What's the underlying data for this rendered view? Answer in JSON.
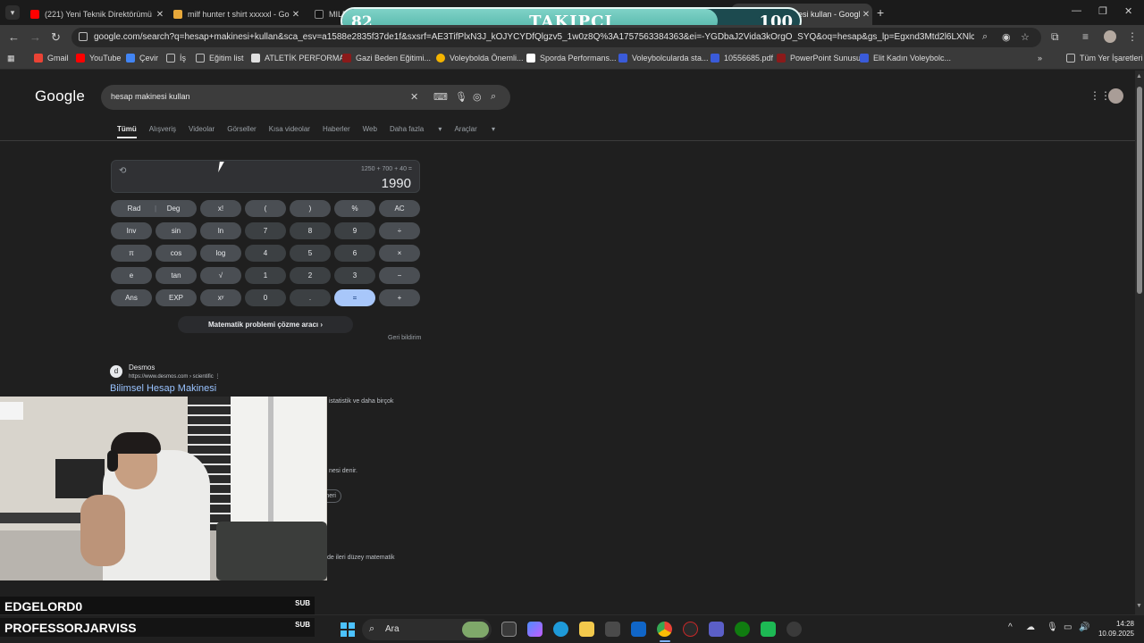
{
  "browser": {
    "tabs": [
      {
        "title": "(221) Yeni Teknik Direktörümü",
        "favicon_color": "#ff0000",
        "active": false
      },
      {
        "title": "milf hunter t shirt xxxxxl - Goog",
        "favicon_color": "#e7a83a",
        "active": false
      },
      {
        "title": "MILF",
        "favicon_color": "#111111",
        "active": false
      },
      {
        "title": "hesap makinesi kullan - Google",
        "favicon_color": "#5f8cff",
        "active": true
      }
    ],
    "new_tab_icon": "plus-icon",
    "url": "google.com/search?q=hesap+makinesi+kullan&sca_esv=a1588e2835f37de1f&sxsrf=AE3TifPlxN3J_kOJYCYDfQlgzv5_1w0z8Q%3A1757563384363&ei=-YGDbaJ2Vida3kOrgO_SYQ&oq=hesap&gs_lp=Egxnd3Mtd2l6LXNlcnAiBWhlc2FwKgIIAD..."
  },
  "overlay": {
    "current": "82",
    "label": "TAKIPÇI",
    "goal": "100",
    "progress": 0.82
  },
  "bookmarks": [
    {
      "label": "Gmail",
      "color": "#ea4335"
    },
    {
      "label": "YouTube",
      "color": "#ff0000"
    },
    {
      "label": "Çevir",
      "color": "#4285f4"
    },
    {
      "label": "İş",
      "color": "#9e9e9e"
    },
    {
      "label": "Eğitim list",
      "color": "#9e9e9e"
    },
    {
      "label": "ATLETİK PERFORMA...",
      "color": "#e0e0e0"
    },
    {
      "label": "Gazi Beden Eğitimi...",
      "color": "#8b1a1a"
    },
    {
      "label": "Voleybolda Önemli...",
      "color": "#f4b400"
    },
    {
      "label": "Sporda Performans...",
      "color": "#ffffff"
    },
    {
      "label": "Voleybolcularda sta...",
      "color": "#3a5bd9"
    },
    {
      "label": "10556685.pdf",
      "color": "#3a5bd9"
    },
    {
      "label": "PowerPoint Sunusu",
      "color": "#8b1a1a"
    },
    {
      "label": "Elit Kadın Voleybolc...",
      "color": "#3a5bd9"
    }
  ],
  "bookmarks_all": "Tüm Yer İşaretleri",
  "google": {
    "logo": "Google",
    "query": "hesap makinesi kullan",
    "tabs": [
      "Tümü",
      "Alışveriş",
      "Videolar",
      "Görseller",
      "Kısa videolar",
      "Haberler",
      "Web",
      "Daha fazla",
      "Araçlar"
    ]
  },
  "calculator": {
    "expression": "1250 + 700 + 40 =",
    "result": "1990",
    "keys": [
      [
        "Rad|Deg",
        "x!",
        "(",
        ")",
        "%",
        "AC"
      ],
      [
        "Inv",
        "sin",
        "ln",
        "7",
        "8",
        "9",
        "÷"
      ],
      [
        "π",
        "cos",
        "log",
        "4",
        "5",
        "6",
        "×"
      ],
      [
        "e",
        "tan",
        "√",
        "1",
        "2",
        "3",
        "−"
      ],
      [
        "Ans",
        "EXP",
        "xʸ",
        "0",
        ".",
        "=",
        "+"
      ]
    ],
    "rad_label": "Rad",
    "deg_label": "Deg",
    "solver": "Matematik problemi çözme aracı",
    "feedback": "Geri bildirim"
  },
  "result": {
    "site": "Desmos",
    "url": "https://www.desmos.com › scientific",
    "title": "Bilimsel Hesap Makinesi",
    "snippet1": "istatistik ve daha birçok",
    "snippet2": "nesi denir.",
    "chip": "neri",
    "snippet3": "de ileri düzey matematik"
  },
  "stream": {
    "sub1_name": "EDGELORD0",
    "sub1_tag": "SUB",
    "sub2_name": "PROFESSORJARVISS",
    "sub2_tag": "SUB"
  },
  "taskbar": {
    "search": "Ara",
    "time": "14:28",
    "date": "10.09.2025"
  }
}
